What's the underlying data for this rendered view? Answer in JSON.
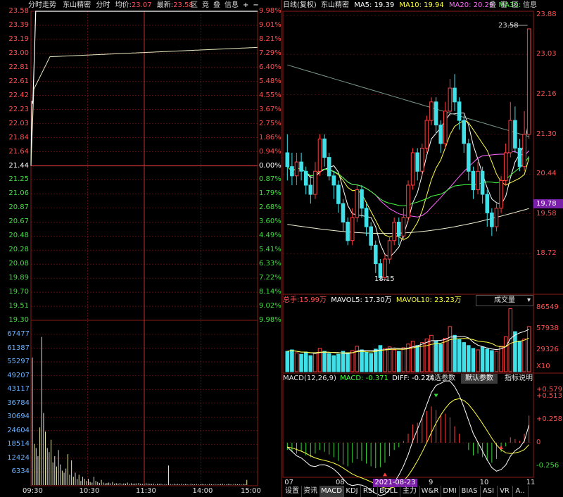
{
  "left_panel": {
    "header": {
      "mode_label": "分时走势",
      "stock_name": "东山精密",
      "mode2_label": "分时",
      "avg_label": "均价:",
      "avg_value": "23.07",
      "last_label": "最新:",
      "last_value": "23.58",
      "buttons": [
        "区",
        "竞",
        "叠",
        "信息"
      ],
      "plus": "+",
      "minus": "−"
    },
    "price_ticks": [
      "23.58",
      "23.39",
      "23.19",
      "23.00",
      "22.81",
      "22.61",
      "22.42",
      "22.23",
      "22.03",
      "21.84",
      "21.64",
      "21.44",
      "21.25",
      "21.06",
      "20.87",
      "20.67",
      "20.48",
      "20.28",
      "20.08",
      "19.89",
      "19.70",
      "19.51",
      "19.30"
    ],
    "pct_ticks": [
      "9.98%",
      "9.01%",
      "8.21%",
      "7.29%",
      "6.40%",
      "5.48%",
      "4.55%",
      "3.67%",
      "2.75%",
      "1.86%",
      "0.94%",
      "0.00%",
      "0.87%",
      "1.79%",
      "2.68%",
      "3.60%",
      "4.49%",
      "5.41%",
      "6.33%",
      "7.22%",
      "8.14%",
      "9.02%",
      "9.98%"
    ],
    "volume_ticks": [
      "67477",
      "61387",
      "55297",
      "49207",
      "43117",
      "36784",
      "30694",
      "24604",
      "18514",
      "12424",
      "6334"
    ],
    "time_ticks": [
      "09:30",
      "10:30",
      "11:30",
      "14:00",
      "15:00"
    ],
    "prev_close": 21.44,
    "price_max": 23.58,
    "price_min": 19.3,
    "volume_max": 73567,
    "volume_bars": [
      62000,
      20000,
      18000,
      14000,
      28000,
      72000,
      35000,
      26000,
      18000,
      16000,
      22000,
      11000,
      14000,
      9000,
      17000,
      10000,
      7000,
      6000,
      8000,
      15000,
      5000,
      12000,
      4000,
      6000,
      3000,
      5000,
      2000,
      4000,
      3000,
      2000,
      3000,
      1500,
      1200,
      4000,
      2000,
      1500,
      1000,
      2500,
      1200,
      800,
      1000,
      1200,
      800,
      1500,
      600,
      900,
      700,
      1000,
      500,
      800,
      700,
      1200,
      600,
      900,
      500,
      700,
      800,
      1000,
      600,
      500,
      400,
      900,
      700,
      600,
      500,
      700,
      400,
      600,
      500,
      600,
      400,
      500,
      300,
      9500,
      500,
      400,
      600,
      300,
      500,
      400,
      600,
      300,
      500,
      400,
      300,
      600,
      400,
      300,
      500,
      400,
      300,
      500,
      300,
      400,
      300,
      500,
      400,
      300,
      500,
      400,
      300,
      500,
      600,
      400,
      300,
      500,
      400,
      300,
      500,
      400,
      300,
      400,
      300,
      500,
      400,
      2500
    ],
    "colors": {
      "price_line": "#ffffff",
      "avg_line": "#ffff66",
      "grid": "#8b1a1a",
      "up": "#ff4040",
      "down": "#39d939"
    }
  },
  "right_panel": {
    "kline_header": {
      "title": "日线(复权)",
      "stock_name": "东山精密",
      "ma5": "MA5: 19.39",
      "ma10": "MA10: 19.94",
      "ma20": "MA20: 20.29",
      "ma30": "MA30:",
      "buttons": [
        "叠",
        "窗",
        "区",
        "信息"
      ]
    },
    "kline_ticks": [
      "23.88",
      "23.03",
      "22.16",
      "21.30",
      "20.44",
      "19.58",
      "18.72"
    ],
    "current_price_tag": "19.78",
    "high_label": "23.58",
    "low_label": "18.15",
    "volume_header": {
      "total_label": "总手:",
      "total_value": "15.99万",
      "mavol5": "MAVOL5: 17.30万",
      "mavol10": "MAVOL10: 23.23万",
      "indicator": "成交量"
    },
    "volume_ticks": [
      "86549",
      "57938",
      "29326",
      "X10"
    ],
    "macd_header": {
      "title": "MACD(12,26,9)",
      "macd": "MACD: -0.371",
      "diff": "DIFF: -0.224",
      "btn1": "优选参数",
      "btn2": "默认参数",
      "btn3": "指标说明"
    },
    "macd_ticks": [
      "0.579",
      "0.513",
      "0.258",
      "0",
      "-0.256"
    ],
    "date_ticks": [
      "07",
      "08",
      "2021-08-23",
      "9",
      "10",
      "11"
    ],
    "chart_data": {
      "type": "candlestick",
      "price_range": [
        17.9,
        23.9
      ],
      "candles": [
        [
          20.9,
          20.6,
          21.3,
          20.3
        ],
        [
          20.6,
          20.4,
          20.9,
          20.2
        ],
        [
          20.4,
          20.7,
          20.9,
          20.2
        ],
        [
          20.7,
          20.5,
          20.9,
          20.3
        ],
        [
          20.5,
          20.2,
          20.6,
          20.0
        ],
        [
          20.2,
          20.0,
          20.4,
          19.8
        ],
        [
          20.0,
          20.5,
          20.7,
          19.9
        ],
        [
          20.5,
          21.2,
          21.3,
          20.4
        ],
        [
          21.2,
          20.8,
          21.3,
          20.6
        ],
        [
          20.8,
          20.4,
          20.9,
          20.3
        ],
        [
          20.4,
          20.2,
          20.5,
          19.9
        ],
        [
          20.2,
          19.8,
          20.3,
          19.6
        ],
        [
          19.8,
          19.4,
          19.9,
          19.2
        ],
        [
          19.4,
          19.0,
          19.5,
          18.9
        ],
        [
          19.0,
          19.5,
          19.7,
          18.9
        ],
        [
          19.5,
          20.1,
          20.2,
          19.4
        ],
        [
          20.1,
          19.7,
          20.2,
          19.5
        ],
        [
          19.7,
          19.3,
          19.8,
          19.1
        ],
        [
          19.3,
          18.9,
          19.4,
          18.8
        ],
        [
          18.9,
          18.5,
          19.0,
          18.3
        ],
        [
          18.5,
          18.2,
          18.6,
          18.15
        ],
        [
          18.2,
          18.6,
          18.7,
          18.15
        ],
        [
          18.6,
          19.0,
          19.1,
          18.5
        ],
        [
          19.0,
          19.4,
          19.5,
          18.9
        ],
        [
          19.4,
          19.1,
          19.5,
          18.9
        ],
        [
          19.1,
          19.5,
          19.7,
          19.0
        ],
        [
          19.5,
          20.2,
          20.3,
          19.4
        ],
        [
          20.2,
          20.9,
          21.0,
          20.1
        ],
        [
          20.9,
          20.5,
          21.0,
          20.3
        ],
        [
          20.5,
          21.0,
          21.1,
          20.4
        ],
        [
          21.0,
          21.6,
          21.7,
          20.9
        ],
        [
          21.6,
          22.0,
          22.1,
          21.5
        ],
        [
          22.0,
          21.5,
          22.1,
          21.3
        ],
        [
          21.5,
          21.1,
          21.6,
          20.9
        ],
        [
          21.1,
          21.8,
          22.0,
          21.0
        ],
        [
          21.8,
          22.3,
          22.5,
          21.7
        ],
        [
          22.3,
          22.0,
          22.6,
          21.8
        ],
        [
          22.0,
          21.6,
          22.1,
          21.4
        ],
        [
          21.6,
          21.1,
          21.7,
          20.9
        ],
        [
          21.1,
          20.5,
          21.2,
          20.3
        ],
        [
          20.5,
          20.1,
          20.6,
          19.9
        ],
        [
          20.1,
          20.5,
          20.7,
          20.0
        ],
        [
          20.5,
          20.0,
          20.6,
          19.8
        ],
        [
          20.0,
          19.6,
          20.1,
          19.3
        ],
        [
          19.6,
          19.3,
          19.7,
          19.1
        ],
        [
          19.3,
          19.7,
          19.8,
          19.2
        ],
        [
          19.7,
          20.3,
          20.4,
          19.6
        ],
        [
          20.3,
          20.9,
          21.1,
          20.2
        ],
        [
          20.9,
          21.6,
          22.0,
          20.8
        ],
        [
          21.6,
          21.0,
          21.9,
          20.9
        ],
        [
          21.0,
          20.6,
          21.2,
          20.5
        ],
        [
          20.6,
          21.3,
          21.8,
          20.5
        ],
        [
          21.3,
          23.58,
          23.58,
          21.2
        ]
      ],
      "volumes": [
        28000,
        30000,
        26000,
        24000,
        27000,
        22000,
        26000,
        32000,
        28000,
        25000,
        22000,
        24000,
        28000,
        26000,
        29000,
        35000,
        30000,
        27000,
        25000,
        31000,
        36000,
        32000,
        34000,
        30000,
        28000,
        33000,
        38000,
        42000,
        36000,
        40000,
        45000,
        50000,
        42000,
        38000,
        46000,
        62000,
        50000,
        44000,
        40000,
        36000,
        32000,
        30000,
        34000,
        31000,
        29000,
        28000,
        35000,
        48000,
        86549,
        55000,
        42000,
        45000,
        62000
      ],
      "macd_hist": [
        -0.08,
        -0.1,
        -0.12,
        -0.1,
        -0.14,
        -0.16,
        -0.12,
        -0.08,
        -0.1,
        -0.13,
        -0.16,
        -0.2,
        -0.24,
        -0.26,
        -0.22,
        -0.18,
        -0.2,
        -0.23,
        -0.26,
        -0.28,
        -0.27,
        -0.22,
        -0.15,
        -0.08,
        -0.05,
        0.02,
        0.1,
        0.2,
        0.22,
        0.28,
        0.35,
        0.4,
        0.36,
        0.3,
        0.32,
        0.28,
        0.18,
        0.1,
        0.0,
        -0.08,
        -0.14,
        -0.12,
        -0.16,
        -0.2,
        -0.22,
        -0.18,
        -0.1,
        -0.04,
        0.06,
        0.04,
        0.02,
        0.1,
        0.3
      ],
      "macd_range": [
        -0.35,
        0.62
      ]
    }
  },
  "bottom_tabs": [
    "设置",
    "资讯",
    "MACD",
    "KDJ",
    "RSI",
    "BOLL",
    "主力",
    "W&R",
    "DMI",
    "BIAS",
    "ASI",
    "VR",
    "A.."
  ],
  "active_tab": "MACD"
}
